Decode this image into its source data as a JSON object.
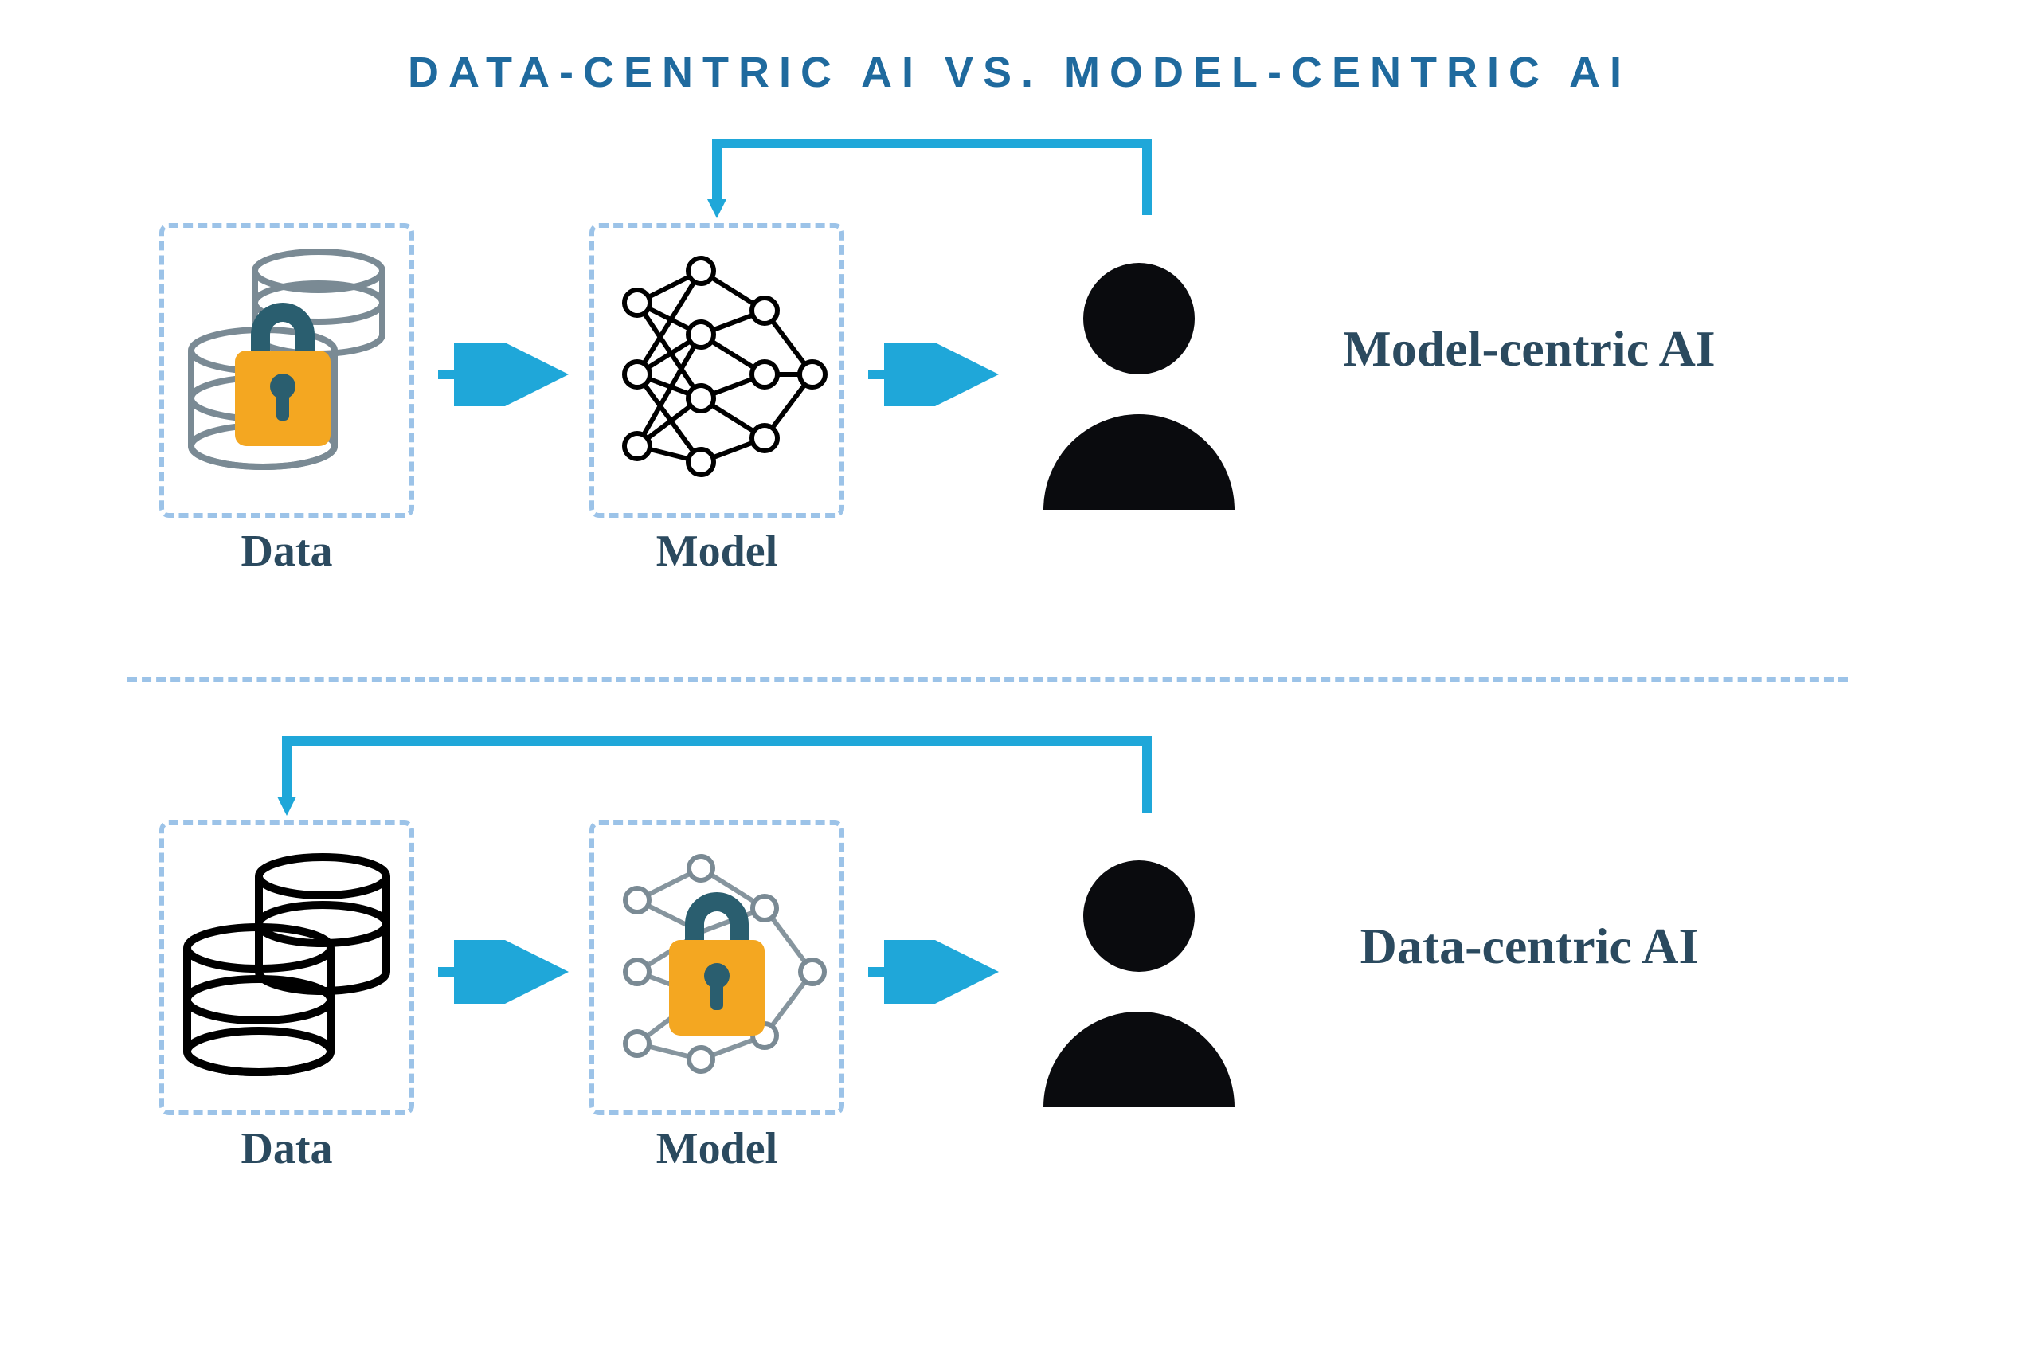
{
  "title": "DATA-CENTRIC AI VS. MODEL-CENTRIC AI",
  "top": {
    "data_label": "Data",
    "model_label": "Model",
    "flow_label": "Model-centric AI"
  },
  "bottom": {
    "data_label": "Data",
    "model_label": "Model",
    "flow_label": "Data-centric AI"
  },
  "colors": {
    "title": "#1f6a9e",
    "dash": "#9cc3e8",
    "arrow": "#1fa7d9",
    "lock_body": "#f4a721",
    "lock_shackle": "#2a5e6f",
    "text": "#2b4a5f",
    "graylines": "#7a8a94"
  }
}
